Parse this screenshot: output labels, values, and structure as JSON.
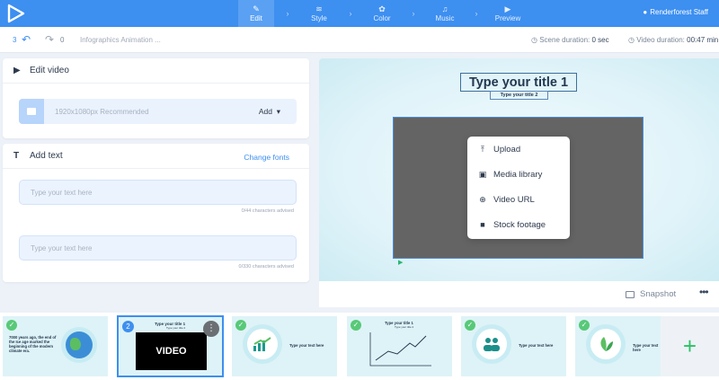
{
  "nav": {
    "steps": [
      {
        "label": "Edit",
        "icon": "pencil-icon"
      },
      {
        "label": "Style",
        "icon": "layers-icon"
      },
      {
        "label": "Color",
        "icon": "palette-icon"
      },
      {
        "label": "Music",
        "icon": "music-icon"
      },
      {
        "label": "Preview",
        "icon": "play-icon"
      }
    ],
    "active_step": "Edit",
    "user": "Renderforest Staff"
  },
  "toolbar": {
    "undo_count": "3",
    "redo_count": "0",
    "project_name": "Infographics Animation ...",
    "scene_duration_label": "Scene duration:",
    "scene_duration_value": "0 sec",
    "video_duration_label": "Video duration:",
    "video_duration_value": "00:47 min"
  },
  "edit_video": {
    "title": "Edit video",
    "hint": "1920x1080px Recommended",
    "add_label": "Add"
  },
  "add_text": {
    "title": "Add text",
    "change_fonts": "Change fonts",
    "field1_placeholder": "Type your text here",
    "field1_hint": "0/44 characters advised",
    "field2_placeholder": "Type your text here",
    "field2_hint": "0/330 characters advised"
  },
  "preview": {
    "title": "Type your title 1",
    "subtitle": "Type your title 2",
    "menu": [
      {
        "label": "Upload",
        "icon": "upload-icon"
      },
      {
        "label": "Media library",
        "icon": "media-library-icon"
      },
      {
        "label": "Video URL",
        "icon": "globe-icon"
      },
      {
        "label": "Stock footage",
        "icon": "camera-icon"
      }
    ],
    "snapshot_label": "Snapshot",
    "more_label": "•••"
  },
  "scenes": [
    {
      "text": "7000 years ago, the end of the Ice age marked the beginning of the modern climate era.",
      "icon": "globe-icon",
      "status": "done"
    },
    {
      "number": "2",
      "title": "Type your title 1",
      "subtitle": "Type your title 2",
      "video_label": "VIDEO",
      "status": "selected"
    },
    {
      "text": "Type your text here",
      "icon": "chart-up-icon",
      "status": "done"
    },
    {
      "title": "Type your title 1",
      "subtitle": "Type your title 2",
      "icon": "line-chart-icon",
      "status": "done"
    },
    {
      "text": "Type your text here",
      "icon": "people-icon",
      "status": "done"
    },
    {
      "text": "Type your text here",
      "icon": "leaf-icon",
      "status": "done"
    }
  ],
  "add_scene_label": "+",
  "colors": {
    "primary": "#3d8ff0",
    "success": "#58c978",
    "add_green": "#2bc265",
    "stage_bg": "#dff3f9"
  }
}
